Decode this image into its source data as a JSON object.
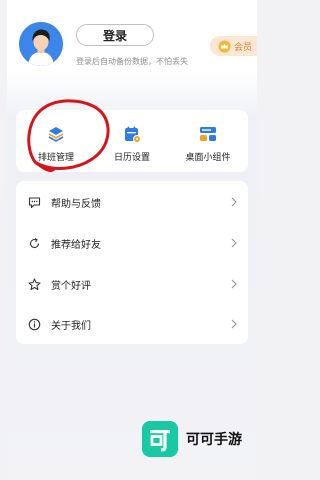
{
  "header": {
    "login_label": "登录",
    "hint": "登录后自动备份数据，不怕丢失",
    "vip_label": "会员"
  },
  "tools": [
    {
      "label": "排班管理",
      "icon": "layers-icon"
    },
    {
      "label": "日历设置",
      "icon": "calendar-settings-icon"
    },
    {
      "label": "桌面小组件",
      "icon": "widget-icon"
    }
  ],
  "menu": [
    {
      "label": "帮助与反馈",
      "icon": "feedback-icon"
    },
    {
      "label": "推荐给好友",
      "icon": "share-icon"
    },
    {
      "label": "赏个好评",
      "icon": "star-icon"
    },
    {
      "label": "关于我们",
      "icon": "info-icon"
    }
  ],
  "watermark": {
    "text": "可可手游"
  },
  "colors": {
    "accent": "#2f7de1",
    "brand_watermark": "#19c9a4",
    "annotation": "#d8141b"
  }
}
